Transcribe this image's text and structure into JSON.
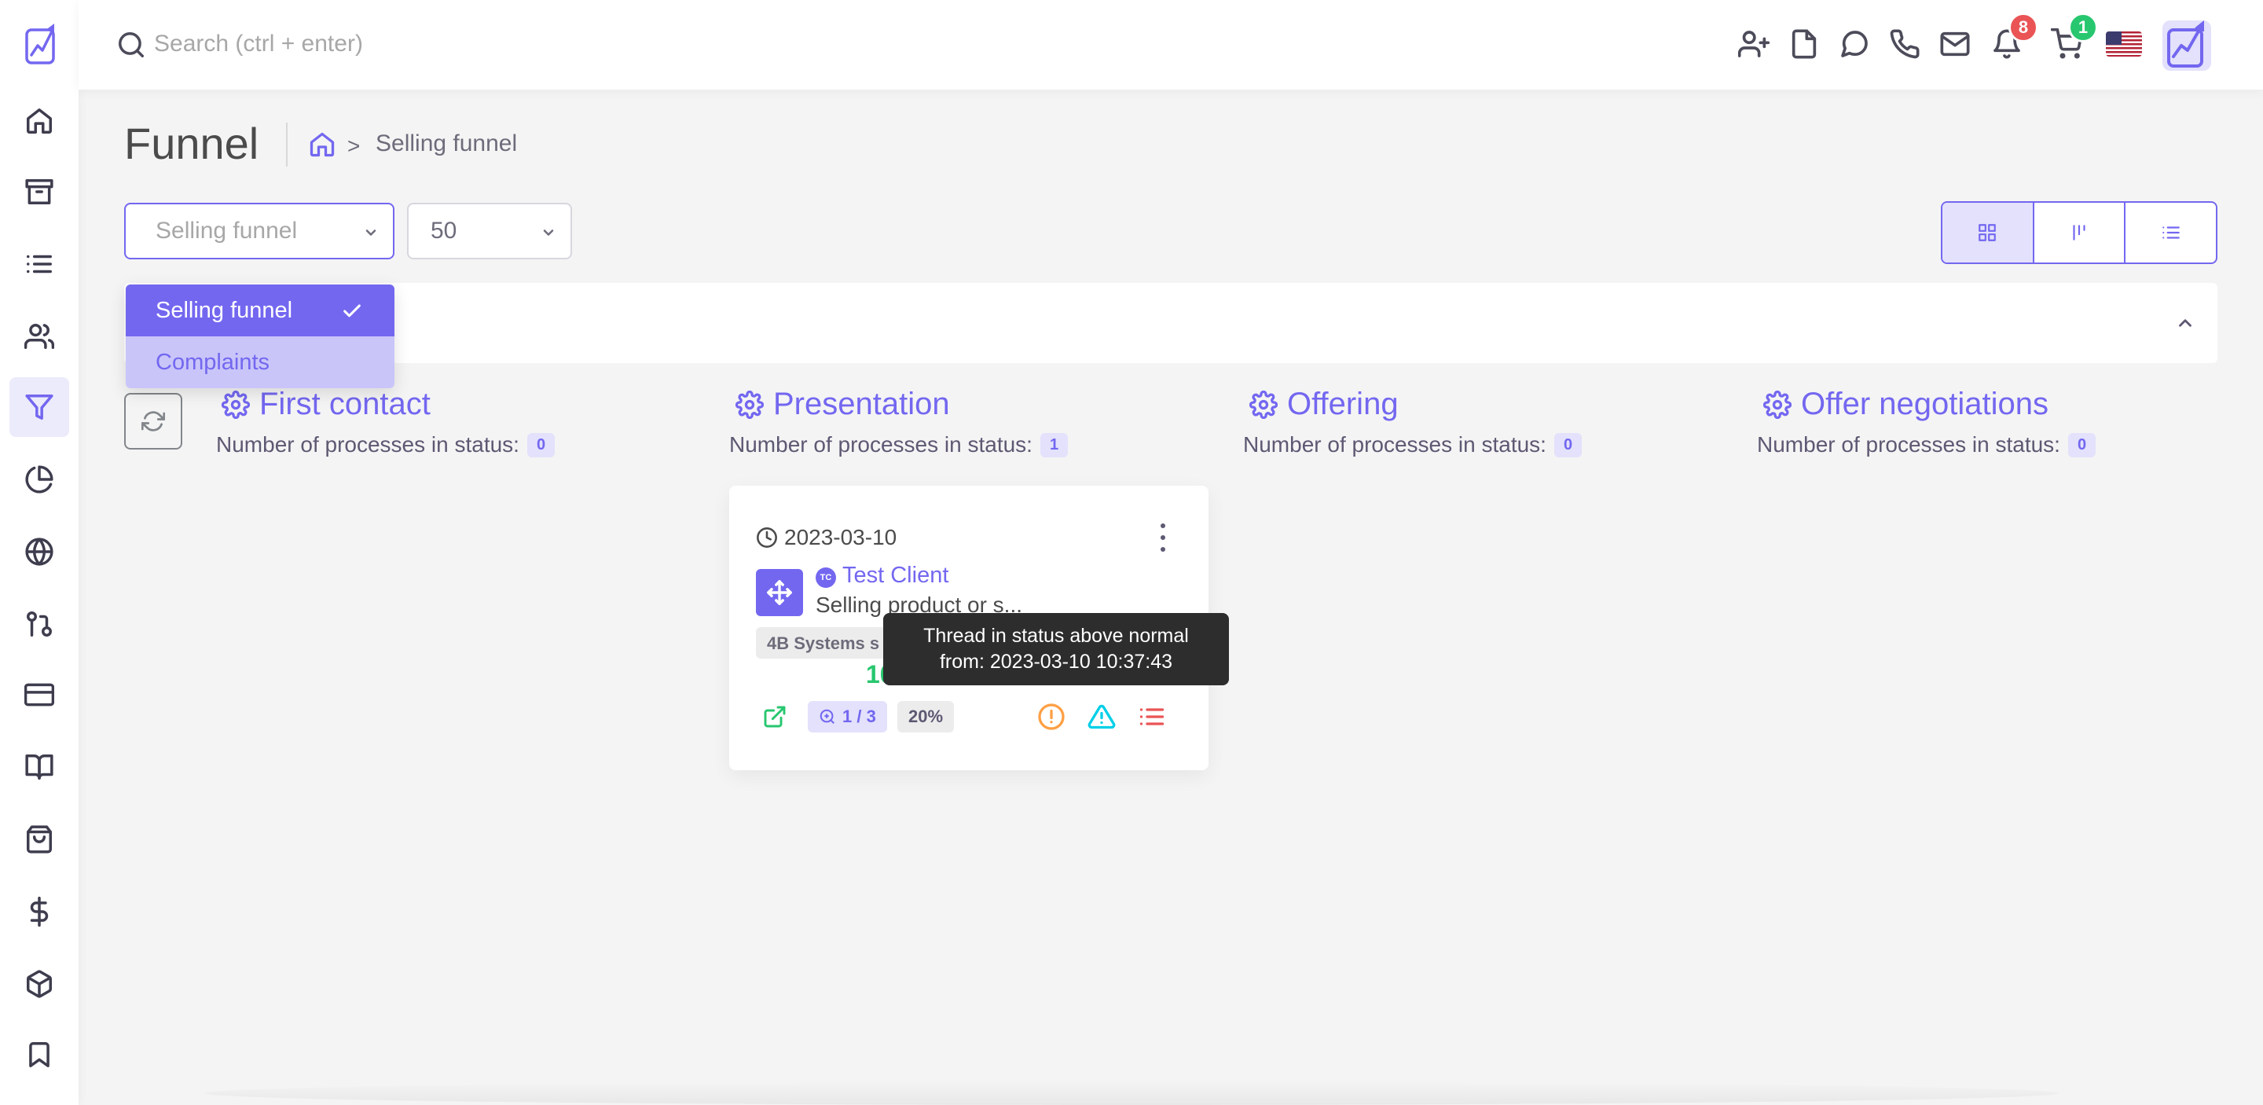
{
  "header": {
    "search_placeholder": "Search (ctrl + enter)",
    "notification_count": "8",
    "cart_count": "1"
  },
  "page": {
    "title": "Funnel",
    "breadcrumb_current": "Selling funnel",
    "breadcrumb_separator": ">"
  },
  "filters": {
    "funnel_select_value": "Selling funnel",
    "limit_select_value": "50"
  },
  "dropdown": {
    "options": [
      {
        "label": "Selling funnel",
        "selected": true
      },
      {
        "label": "Complaints",
        "selected": false
      }
    ]
  },
  "columns": [
    {
      "title": "First contact",
      "count_label": "Number of processes in status:",
      "count": "0"
    },
    {
      "title": "Presentation",
      "count_label": "Number of processes in status:",
      "count": "1"
    },
    {
      "title": "Offering",
      "count_label": "Number of processes in status:",
      "count": "0"
    },
    {
      "title": "Offer negotiations",
      "count_label": "Number of processes in status:",
      "count": "0"
    }
  ],
  "card": {
    "date": "2023-03-10",
    "client_initials": "TC",
    "client_name": "Test Client",
    "description": "Selling product or s...",
    "company": "4B Systems s",
    "value": "10",
    "stage": "1 / 3",
    "percent": "20%"
  },
  "tooltip": {
    "line1": "Thread in status above normal",
    "line2": "from: 2023-03-10 10:37:43"
  },
  "colors": {
    "accent": "#7367f0",
    "success": "#28c76f",
    "danger": "#ea5455",
    "warning": "#ff9f43",
    "info": "#00cfe8"
  }
}
